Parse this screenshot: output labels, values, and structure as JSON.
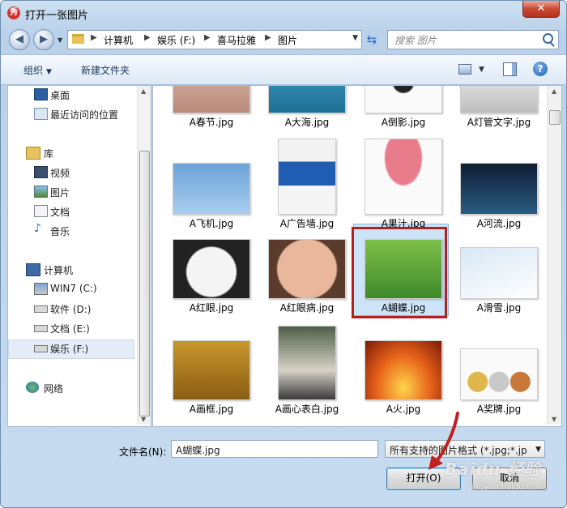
{
  "window": {
    "title": "打开一张图片",
    "close_glyph": "✕",
    "app_icon": "秀"
  },
  "address": {
    "crumbs": [
      "计算机",
      "娱乐 (F:)",
      "喜马拉雅",
      "图片"
    ],
    "search_placeholder": "搜索 图片"
  },
  "toolbar": {
    "organize": "组织",
    "new_folder": "新建文件夹"
  },
  "nav": {
    "favorites": [
      {
        "label": "桌面",
        "icon": "desktop-icon"
      },
      {
        "label": "最近访问的位置",
        "icon": "recent-places-icon"
      }
    ],
    "libraries": {
      "label": "库",
      "items": [
        {
          "label": "视频",
          "icon": "video-library-icon"
        },
        {
          "label": "图片",
          "icon": "pictures-library-icon"
        },
        {
          "label": "文档",
          "icon": "documents-library-icon"
        },
        {
          "label": "音乐",
          "icon": "music-library-icon"
        }
      ]
    },
    "computer": {
      "label": "计算机",
      "items": [
        {
          "label": "WIN7 (C:)",
          "icon": "system-drive-icon"
        },
        {
          "label": "软件 (D:)",
          "icon": "drive-icon"
        },
        {
          "label": "文档 (E:)",
          "icon": "drive-icon"
        },
        {
          "label": "娱乐 (F:)",
          "icon": "drive-icon",
          "selected": true
        }
      ]
    },
    "network": {
      "label": "网络",
      "icon": "network-icon"
    }
  },
  "files": [
    {
      "name": "A春节.jpg",
      "row": 0,
      "col": 0,
      "icon": "spring-festival-thumbnail"
    },
    {
      "name": "A大海.jpg",
      "row": 0,
      "col": 1,
      "icon": "sea-thumbnail"
    },
    {
      "name": "A倒影.jpg",
      "row": 0,
      "col": 2,
      "icon": "reflection-thumbnail"
    },
    {
      "name": "A灯管文字.jpg",
      "row": 0,
      "col": 3,
      "icon": "neon-text-thumbnail"
    },
    {
      "name": "A飞机.jpg",
      "row": 1,
      "col": 0,
      "icon": "airplane-thumbnail"
    },
    {
      "name": "A广告墙.jpg",
      "row": 1,
      "col": 1,
      "icon": "billboard-woman-thumbnail"
    },
    {
      "name": "A果汁.jpg",
      "row": 1,
      "col": 2,
      "icon": "juice-glass-thumbnail"
    },
    {
      "name": "A河流.jpg",
      "row": 1,
      "col": 3,
      "icon": "river-thumbnail"
    },
    {
      "name": "A红眼.jpg",
      "row": 2,
      "col": 0,
      "icon": "white-cat-thumbnail"
    },
    {
      "name": "A红眼病.jpg",
      "row": 2,
      "col": 1,
      "icon": "red-eye-girl-thumbnail"
    },
    {
      "name": "A蝴蝶.jpg",
      "row": 2,
      "col": 2,
      "icon": "butterfly-thumbnail",
      "selected": true
    },
    {
      "name": "A滑雪.jpg",
      "row": 2,
      "col": 3,
      "icon": "skiing-thumbnail"
    },
    {
      "name": "A画框.jpg",
      "row": 3,
      "col": 0,
      "icon": "picture-frame-thumbnail"
    },
    {
      "name": "A画心表白.jpg",
      "row": 3,
      "col": 1,
      "icon": "heart-confession-thumbnail"
    },
    {
      "name": "A火.jpg",
      "row": 3,
      "col": 2,
      "icon": "fire-thumbnail"
    },
    {
      "name": "A奖牌.jpg",
      "row": 3,
      "col": 3,
      "icon": "medals-thumbnail"
    }
  ],
  "footer": {
    "filename_label": "文件名(N):",
    "filename_value": "A蝴蝶.jpg",
    "filter_value": "所有支持的图片格式 (*.jpg;*.jp",
    "open_label": "打开(O)",
    "cancel_label": "取消"
  },
  "watermark": {
    "brand": "Baidu 经验",
    "url": "jingyan.baidu.com"
  },
  "colors": {
    "highlight_box": "#b2201f",
    "selection": "#cde3f8",
    "annotation_arrow": "#c0211e"
  }
}
